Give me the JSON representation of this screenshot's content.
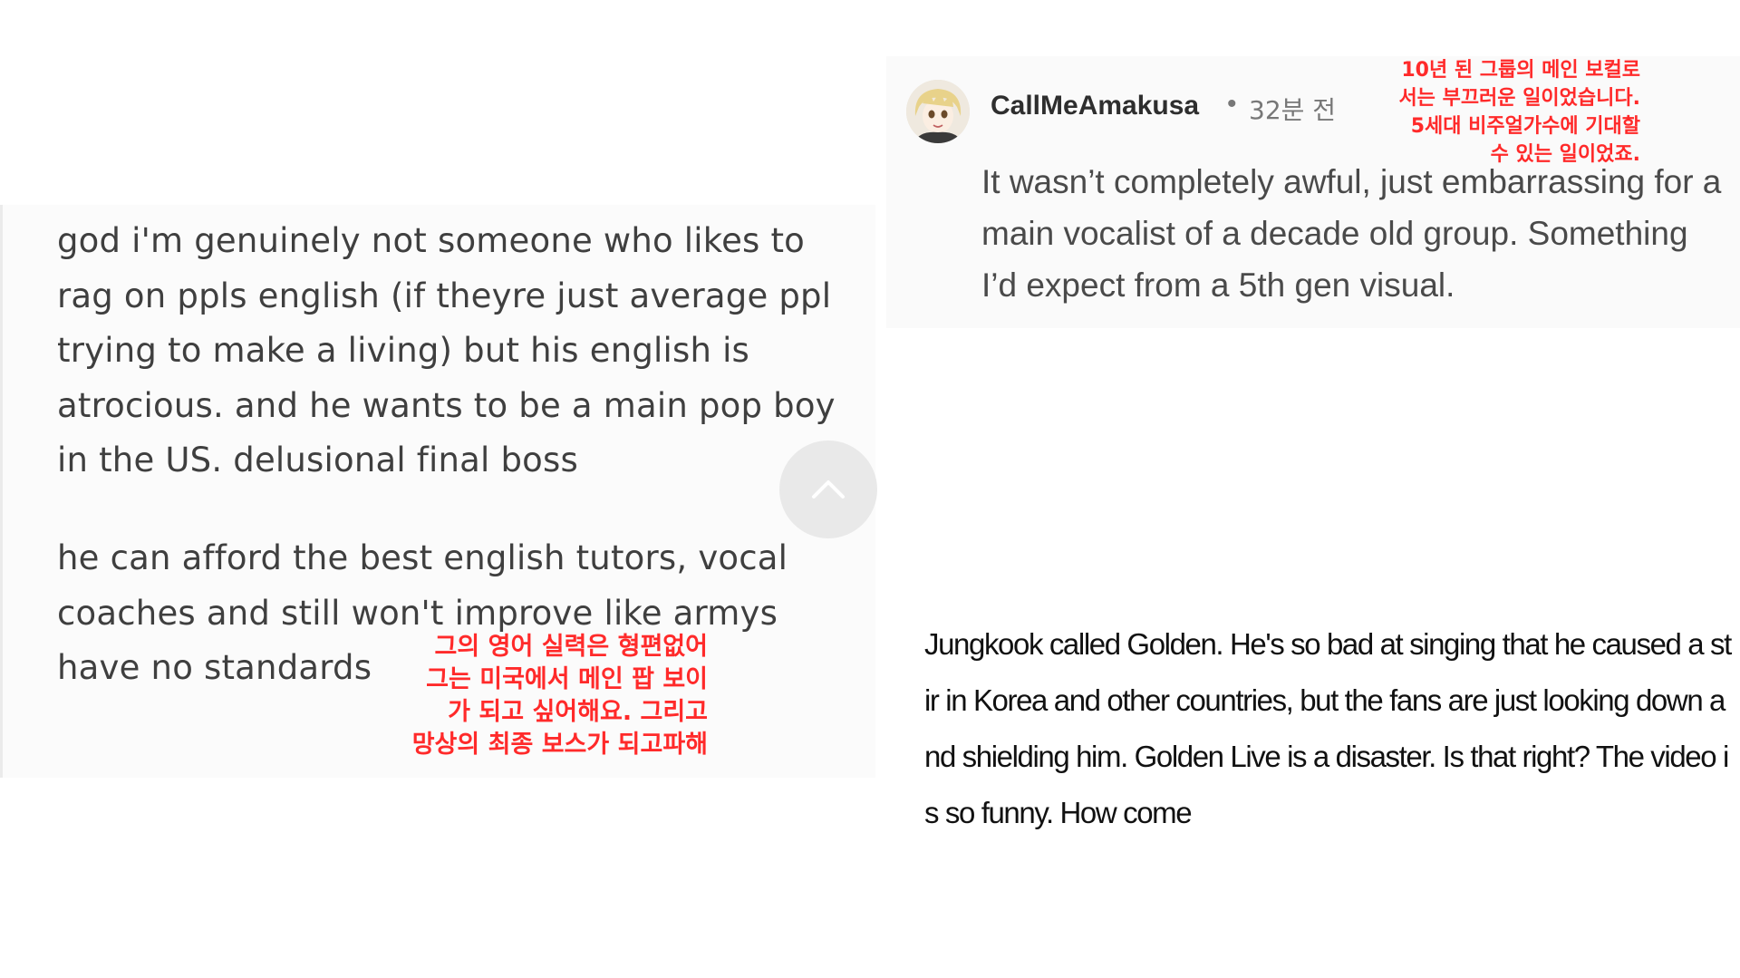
{
  "left_post": {
    "paragraph1": "god i'm genuinely not someone who likes to rag on ppls english (if theyre just average ppl trying to make a living) but his english is atrocious. and he wants to be a main pop boy in the US. delusional final boss",
    "paragraph2": "he can afford the best english tutors, vocal coaches and still won't improve like armys have no standards",
    "korean_caption_lines": [
      "그의 영어 실력은 형편없어",
      "그는 미국에서 메인 팝 보이",
      "가 되고 싶어해요. 그리고",
      "망상의 최종 보스가 되고파해"
    ],
    "scroll_button_icon": "chevron-up-icon"
  },
  "right_comment": {
    "username": "CallMeAmakusa",
    "separator": "•",
    "time_ago": "32분 전",
    "comment": "It wasn’t completely awful, just embarrassing for a main vocalist of a decade old group. Something I’d expect from a 5th gen visual.",
    "korean_caption_lines": [
      "10년 된 그룹의 메인 보컬로",
      "서는 부끄러운 일이었습니다.",
      "5세대 비주얼가수에 기대할",
      "수 있는 일이었죠."
    ],
    "avatar_icon": "anime-avatar-icon"
  },
  "bottom_paragraph": "Jungkook called Golden. He's so bad at singing that he caused a stir in Korea and other countries, but the fans are just looking down and shielding him. Golden Live is a disaster. Is that right? The video is so funny. How come",
  "colors": {
    "caption_red": "#ff2a2a",
    "left_text": "#3f3f3f",
    "right_text": "#4a4a4a",
    "bottom_text": "#111111"
  }
}
